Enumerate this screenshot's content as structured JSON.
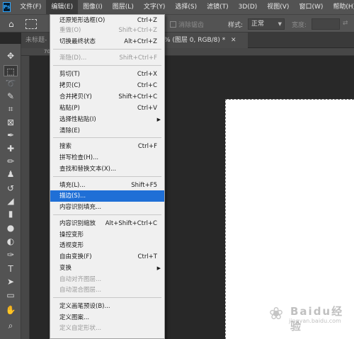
{
  "app": {
    "logo": "Ps"
  },
  "menubar": [
    "文件(F)",
    "编辑(E)",
    "图像(I)",
    "图层(L)",
    "文字(Y)",
    "选择(S)",
    "滤镜(T)",
    "3D(D)",
    "视图(V)",
    "窗口(W)",
    "帮助(H)"
  ],
  "options": {
    "antialias": "消除锯齿",
    "style_label": "样式:",
    "style_value": "正常",
    "width_label": "宽度:"
  },
  "tabs": {
    "tab1": "未标题-",
    "tab2": "% (图层 0, RGB/8) *"
  },
  "ruler": {
    "mark": "70"
  },
  "edit_menu": {
    "items": [
      {
        "label": "还原矩形选框(O)",
        "shortcut": "Ctrl+Z",
        "disabled": false
      },
      {
        "label": "重做(O)",
        "shortcut": "Shift+Ctrl+Z",
        "disabled": true
      },
      {
        "label": "切换最终状态",
        "shortcut": "Alt+Ctrl+Z",
        "disabled": false
      },
      {
        "label": "渐隐(D)...",
        "shortcut": "Shift+Ctrl+F",
        "disabled": true
      },
      {
        "label": "剪切(T)",
        "shortcut": "Ctrl+X",
        "disabled": false
      },
      {
        "label": "拷贝(C)",
        "shortcut": "Ctrl+C",
        "disabled": false
      },
      {
        "label": "合并拷贝(Y)",
        "shortcut": "Shift+Ctrl+C",
        "disabled": false
      },
      {
        "label": "粘贴(P)",
        "shortcut": "Ctrl+V",
        "disabled": false
      },
      {
        "label": "选择性粘贴(I)",
        "shortcut": "",
        "disabled": false,
        "submenu": true
      },
      {
        "label": "清除(E)",
        "shortcut": "",
        "disabled": false
      },
      {
        "label": "搜索",
        "shortcut": "Ctrl+F",
        "disabled": false
      },
      {
        "label": "拼写检查(H)...",
        "shortcut": "",
        "disabled": false
      },
      {
        "label": "查找和替换文本(X)...",
        "shortcut": "",
        "disabled": false
      },
      {
        "label": "填充(L)...",
        "shortcut": "Shift+F5",
        "disabled": false
      },
      {
        "label": "描边(S)...",
        "shortcut": "",
        "disabled": false,
        "highlighted": true
      },
      {
        "label": "内容识别填充...",
        "shortcut": "",
        "disabled": false
      },
      {
        "label": "内容识别缩放",
        "shortcut": "Alt+Shift+Ctrl+C",
        "disabled": false
      },
      {
        "label": "操控变形",
        "shortcut": "",
        "disabled": false
      },
      {
        "label": "透视变形",
        "shortcut": "",
        "disabled": false
      },
      {
        "label": "自由变换(F)",
        "shortcut": "Ctrl+T",
        "disabled": false
      },
      {
        "label": "变换",
        "shortcut": "",
        "disabled": false,
        "submenu": true
      },
      {
        "label": "自动对齐图层...",
        "shortcut": "",
        "disabled": true
      },
      {
        "label": "自动混合图层...",
        "shortcut": "",
        "disabled": true
      },
      {
        "label": "定义画笔预设(B)...",
        "shortcut": "",
        "disabled": false
      },
      {
        "label": "定义图案...",
        "shortcut": "",
        "disabled": false
      },
      {
        "label": "定义自定形状...",
        "shortcut": "",
        "disabled": true
      }
    ]
  },
  "tools": [
    {
      "name": "move-tool-icon",
      "glyph": "✥"
    },
    {
      "name": "marquee-tool-icon",
      "glyph": "⬚",
      "selected": true
    },
    {
      "name": "lasso-tool-icon",
      "glyph": "➰"
    },
    {
      "name": "quick-select-tool-icon",
      "glyph": "✎"
    },
    {
      "name": "crop-tool-icon",
      "glyph": "⌗"
    },
    {
      "name": "frame-tool-icon",
      "glyph": "⊠"
    },
    {
      "name": "eyedropper-tool-icon",
      "glyph": "✒"
    },
    {
      "name": "healing-tool-icon",
      "glyph": "✚"
    },
    {
      "name": "brush-tool-icon",
      "glyph": "✏"
    },
    {
      "name": "stamp-tool-icon",
      "glyph": "♟"
    },
    {
      "name": "history-brush-icon",
      "glyph": "↺"
    },
    {
      "name": "eraser-tool-icon",
      "glyph": "◢"
    },
    {
      "name": "gradient-tool-icon",
      "glyph": "▮"
    },
    {
      "name": "blur-tool-icon",
      "glyph": "●"
    },
    {
      "name": "dodge-tool-icon",
      "glyph": "◐"
    },
    {
      "name": "pen-tool-icon",
      "glyph": "✑"
    },
    {
      "name": "type-tool-icon",
      "glyph": "T"
    },
    {
      "name": "path-select-tool-icon",
      "glyph": "➤"
    },
    {
      "name": "rectangle-tool-icon",
      "glyph": "▭"
    },
    {
      "name": "hand-tool-icon",
      "glyph": "✋"
    },
    {
      "name": "zoom-tool-icon",
      "glyph": "⌕"
    }
  ],
  "watermark": {
    "text": "Baidu经验",
    "url": "jingyan.baidu.com",
    "paw": "❀"
  }
}
